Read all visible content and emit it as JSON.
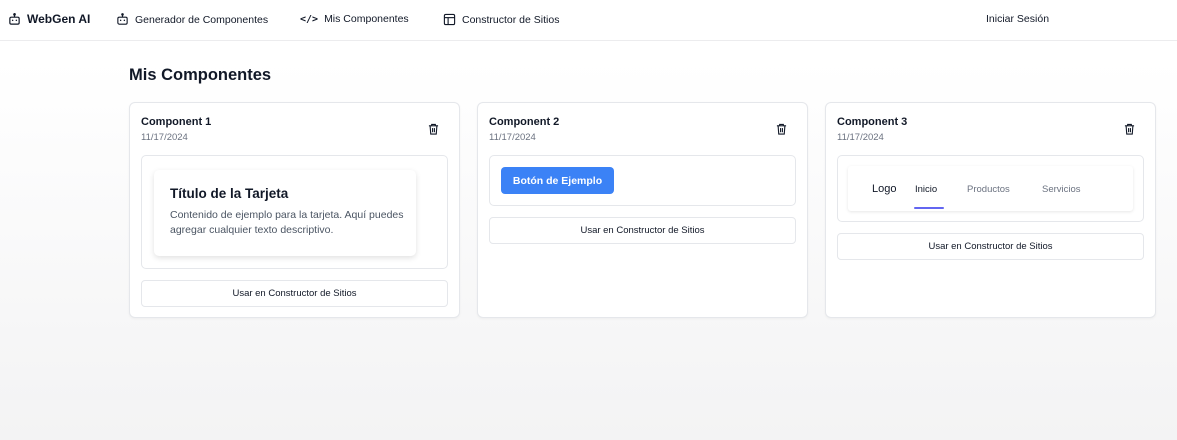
{
  "nav": {
    "brand": "WebGen AI",
    "items": [
      {
        "label": "Generador de Componentes"
      },
      {
        "label": "Mis Componentes"
      },
      {
        "label": "Constructor de Sitios"
      }
    ],
    "login": "Iniciar Sesión"
  },
  "page": {
    "title": "Mis Componentes"
  },
  "components": [
    {
      "name": "Component 1",
      "date": "11/17/2024",
      "preview": {
        "title": "Título de la Tarjeta",
        "text": "Contenido de ejemplo para la tarjeta. Aquí puedes agregar cualquier texto descriptivo."
      },
      "use_label": "Usar en Constructor de Sitios"
    },
    {
      "name": "Component 2",
      "date": "11/17/2024",
      "preview": {
        "button_label": "Botón de Ejemplo"
      },
      "use_label": "Usar en Constructor de Sitios"
    },
    {
      "name": "Component 3",
      "date": "11/17/2024",
      "preview": {
        "logo": "Logo",
        "links": [
          "Inicio",
          "Productos",
          "Servicios"
        ],
        "active_link": "Inicio"
      },
      "use_label": "Usar en Constructor de Sitios"
    }
  ],
  "colors": {
    "primary": "#3b82f6",
    "active_underline": "#6366f1",
    "muted_text": "#6b7280",
    "border": "#e5e7eb"
  },
  "icons": {
    "brand": "robot-icon",
    "generator": "robot-icon",
    "components": "code-icon",
    "builder": "layout-icon",
    "delete": "trash-icon"
  }
}
